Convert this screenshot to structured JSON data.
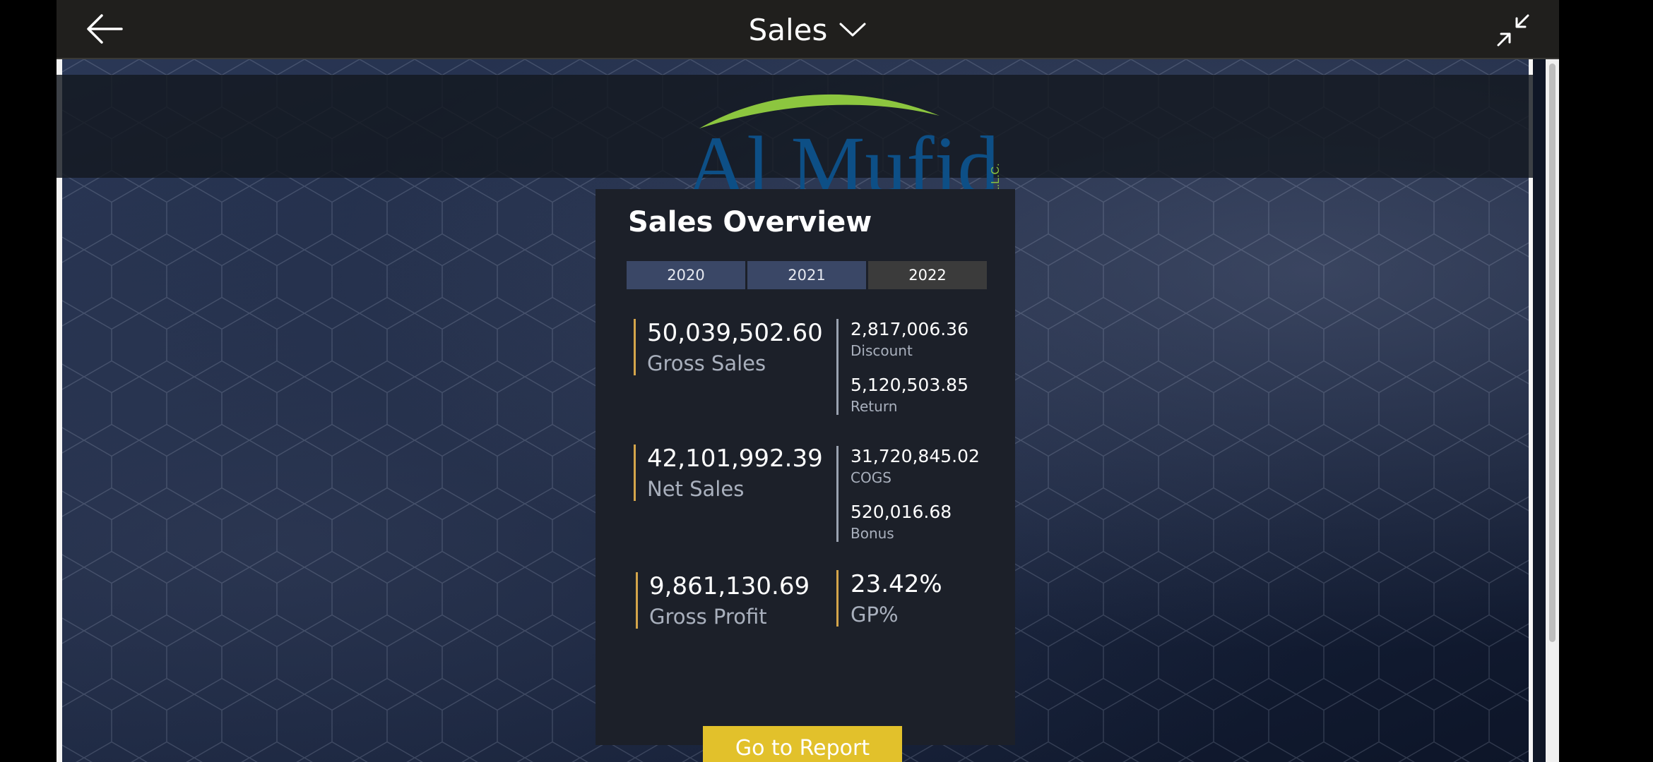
{
  "appbar": {
    "title": "Sales",
    "back_icon": "arrow-left-icon",
    "collapse_icon": "collapse-icon"
  },
  "logo": {
    "text": "Al Mufid",
    "suffix": "L.L.C.",
    "colors": {
      "text": "#0d4f86",
      "swoosh": "#8cc63f"
    }
  },
  "card": {
    "title": "Sales Overview",
    "tabs": [
      {
        "label": "2020",
        "active": false
      },
      {
        "label": "2021",
        "active": false
      },
      {
        "label": "2022",
        "active": true
      }
    ],
    "gross_sales": {
      "value": "50,039,502.60",
      "label": "Gross Sales"
    },
    "discount": {
      "value": "2,817,006.36",
      "label": "Discount"
    },
    "return": {
      "value": "5,120,503.85",
      "label": "Return"
    },
    "net_sales": {
      "value": "42,101,992.39",
      "label": "Net Sales"
    },
    "cogs": {
      "value": "31,720,845.02",
      "label": "COGS"
    },
    "bonus": {
      "value": "520,016.68",
      "label": "Bonus"
    },
    "gross_profit": {
      "value": "9,861,130.69",
      "label": "Gross Profit"
    },
    "gp_pct": {
      "value": "23.42%",
      "label": "GP%"
    },
    "button_label": "Go to Report"
  },
  "colors": {
    "accent_gold": "#d4a54a",
    "button": "#e2c12b",
    "tab": "#3a4766",
    "tab_active": "#3b3b3b",
    "card_bg": "#1c2029"
  }
}
